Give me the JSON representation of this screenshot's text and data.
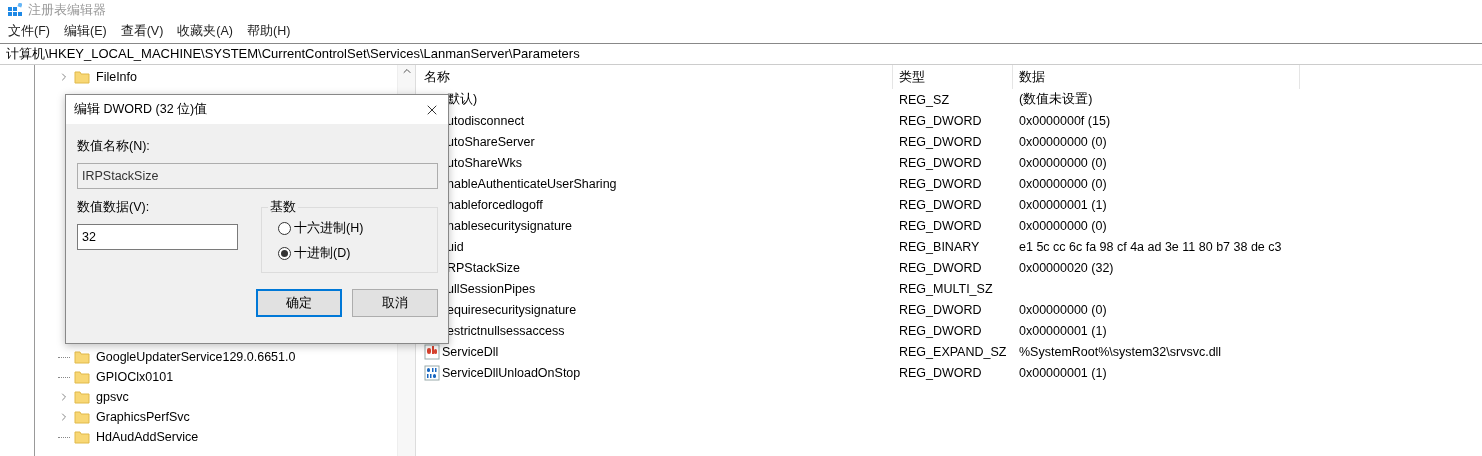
{
  "window": {
    "title": "注册表编辑器"
  },
  "menu": [
    "文件(F)",
    "编辑(E)",
    "查看(V)",
    "收藏夹(A)",
    "帮助(H)"
  ],
  "address": "计算机\\HKEY_LOCAL_MACHINE\\SYSTEM\\CurrentControlSet\\Services\\LanmanServer\\Parameters",
  "tree": {
    "above_dialog": [
      {
        "label": "FileInfo",
        "expandable": true
      }
    ],
    "below_dialog": [
      {
        "label": "GoogleUpdaterService129.0.6651.0",
        "expandable": false
      },
      {
        "label": "GPIOClx0101",
        "expandable": false
      },
      {
        "label": "gpsvc",
        "expandable": true
      },
      {
        "label": "GraphicsPerfSvc",
        "expandable": true
      },
      {
        "label": "HdAudAddService",
        "expandable": false
      }
    ]
  },
  "list": {
    "columns": [
      "名称",
      "类型",
      "数据"
    ],
    "rows": [
      {
        "name": "默认)",
        "type": "REG_SZ",
        "data": "(数值未设置)"
      },
      {
        "name": "utodisconnect",
        "type": "REG_DWORD",
        "data": "0x0000000f (15)"
      },
      {
        "name": "utoShareServer",
        "type": "REG_DWORD",
        "data": "0x00000000 (0)"
      },
      {
        "name": "utoShareWks",
        "type": "REG_DWORD",
        "data": "0x00000000 (0)"
      },
      {
        "name": "nableAuthenticateUserSharing",
        "type": "REG_DWORD",
        "data": "0x00000000 (0)"
      },
      {
        "name": "nableforcedlogoff",
        "type": "REG_DWORD",
        "data": "0x00000001 (1)"
      },
      {
        "name": "nablesecuritysignature",
        "type": "REG_DWORD",
        "data": "0x00000000 (0)"
      },
      {
        "name": "uid",
        "type": "REG_BINARY",
        "data": "e1 5c cc 6c fa 98 cf 4a ad 3e 11 80 b7 38 de c3"
      },
      {
        "name": "RPStackSize",
        "type": "REG_DWORD",
        "data": "0x00000020 (32)"
      },
      {
        "name": "ullSessionPipes",
        "type": "REG_MULTI_SZ"
      },
      {
        "name": "equiresecuritysignature",
        "type": "REG_DWORD",
        "data": "0x00000000 (0)"
      },
      {
        "name": "estrictnullsessaccess",
        "type": "REG_DWORD",
        "data": "0x00000001 (1)"
      },
      {
        "name": "ServiceDll",
        "type": "REG_EXPAND_SZ",
        "data": "%SystemRoot%\\system32\\srvsvc.dll",
        "kind": "string"
      },
      {
        "name": "ServiceDllUnloadOnStop",
        "type": "REG_DWORD",
        "data": "0x00000001 (1)",
        "kind": "binary"
      }
    ]
  },
  "dialog": {
    "title": "编辑 DWORD (32 位)值",
    "name_label": "数值名称(N):",
    "name_value": "IRPStackSize",
    "data_label": "数值数据(V):",
    "data_value": "32",
    "base_label": "基数",
    "bases": [
      {
        "label": "十六进制(H)",
        "selected": false
      },
      {
        "label": "十进制(D)",
        "selected": true
      }
    ],
    "buttons": [
      {
        "label": "确定",
        "default": true
      },
      {
        "label": "取消",
        "default": false
      }
    ]
  }
}
